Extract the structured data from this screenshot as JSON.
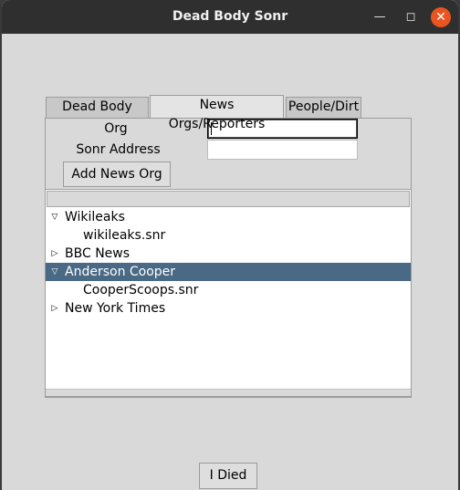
{
  "window": {
    "title": "Dead Body Sonr"
  },
  "tabs": [
    {
      "label": "Dead Body Sonr",
      "active": false
    },
    {
      "label": "News Orgs/Reporters",
      "active": true
    },
    {
      "label": "People/Dirt",
      "active": false
    }
  ],
  "form": {
    "org_label": "Org",
    "org_value": "",
    "address_label": "Sonr Address",
    "address_value": "",
    "add_button": "Add News Org"
  },
  "tree": {
    "rows": [
      {
        "label": "Wikileaks",
        "level": 0,
        "expanded": true,
        "selected": false
      },
      {
        "label": "wikileaks.snr",
        "level": 1,
        "expanded": null,
        "selected": false
      },
      {
        "label": "BBC News",
        "level": 0,
        "expanded": false,
        "selected": false
      },
      {
        "label": "Anderson Cooper",
        "level": 0,
        "expanded": true,
        "selected": true
      },
      {
        "label": "CooperScoops.snr",
        "level": 1,
        "expanded": null,
        "selected": false
      },
      {
        "label": "New York Times",
        "level": 0,
        "expanded": false,
        "selected": false
      }
    ]
  },
  "footer": {
    "died_button": "I Died"
  },
  "colors": {
    "selection": "#4a6984",
    "titlebar": "#2f2f2f",
    "close": "#e95420"
  }
}
